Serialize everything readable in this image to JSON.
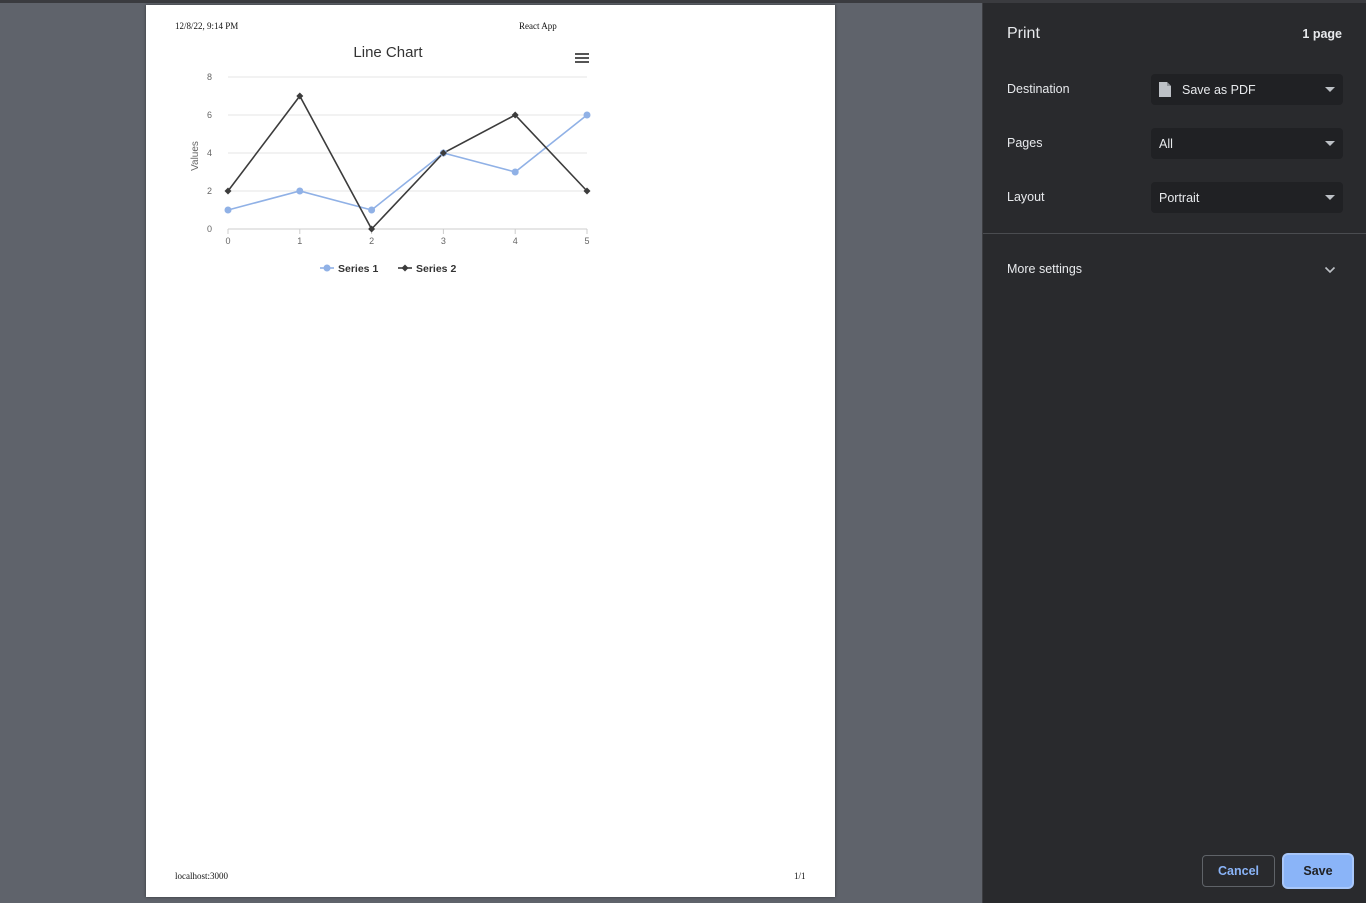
{
  "preview": {
    "header_date": "12/8/22, 9:14 PM",
    "header_title": "React App",
    "footer_url": "localhost:3000",
    "footer_page": "1/1"
  },
  "chart_data": {
    "type": "line",
    "title": "Line Chart",
    "ylabel": "Values",
    "xlabel": "",
    "x": [
      0,
      1,
      2,
      3,
      4,
      5
    ],
    "ylim": [
      0,
      8
    ],
    "yticks": [
      0,
      2,
      4,
      6,
      8
    ],
    "grid": true,
    "legend": "bottom-center",
    "series": [
      {
        "name": "Series 1",
        "values": [
          1,
          2,
          1,
          4,
          3,
          6
        ],
        "color": "#90b1e6",
        "marker": "circle"
      },
      {
        "name": "Series 2",
        "values": [
          2,
          7,
          0,
          4,
          6,
          2
        ],
        "color": "#3c3c3c",
        "marker": "diamond"
      }
    ],
    "menu_icon": "hamburger-menu-icon"
  },
  "panel": {
    "title": "Print",
    "page_count": "1 page",
    "destination_label": "Destination",
    "destination_value": "Save as PDF",
    "pages_label": "Pages",
    "pages_value": "All",
    "layout_label": "Layout",
    "layout_value": "Portrait",
    "more_settings": "More settings",
    "cancel": "Cancel",
    "save": "Save",
    "accent": "#8ab4f8"
  }
}
